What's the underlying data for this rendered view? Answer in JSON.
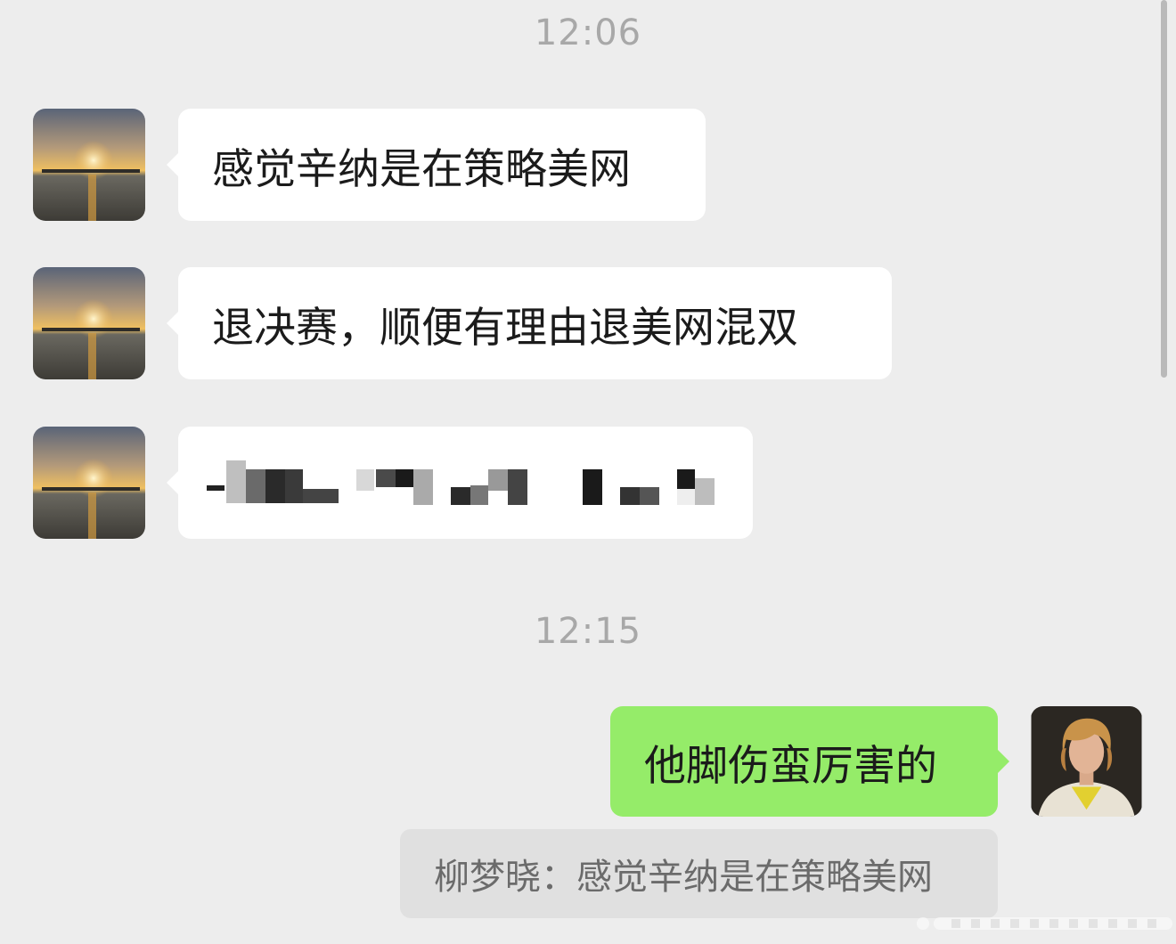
{
  "timestamps": [
    "12:06",
    "12:15"
  ],
  "messages": [
    {
      "side": "incoming",
      "text": "感觉辛纳是在策略美网"
    },
    {
      "side": "incoming",
      "text": "退决赛，顺便有理由退美网混双"
    },
    {
      "side": "incoming",
      "text": "",
      "obscured": true
    },
    {
      "side": "outgoing",
      "text": "他脚伤蛮厉害的"
    }
  ],
  "quote": {
    "text": "柳梦晓：感觉辛纳是在策略美网"
  },
  "icons": {
    "incoming_avatar": "sunset-photo-avatar",
    "outgoing_avatar": "blond-man-photo-avatar"
  },
  "colors": {
    "background": "#ededed",
    "incoming_bubble": "#ffffff",
    "outgoing_bubble": "#95ec69",
    "quote_box": "#e0e0e0",
    "timestamp_text": "#a8a8a8"
  }
}
